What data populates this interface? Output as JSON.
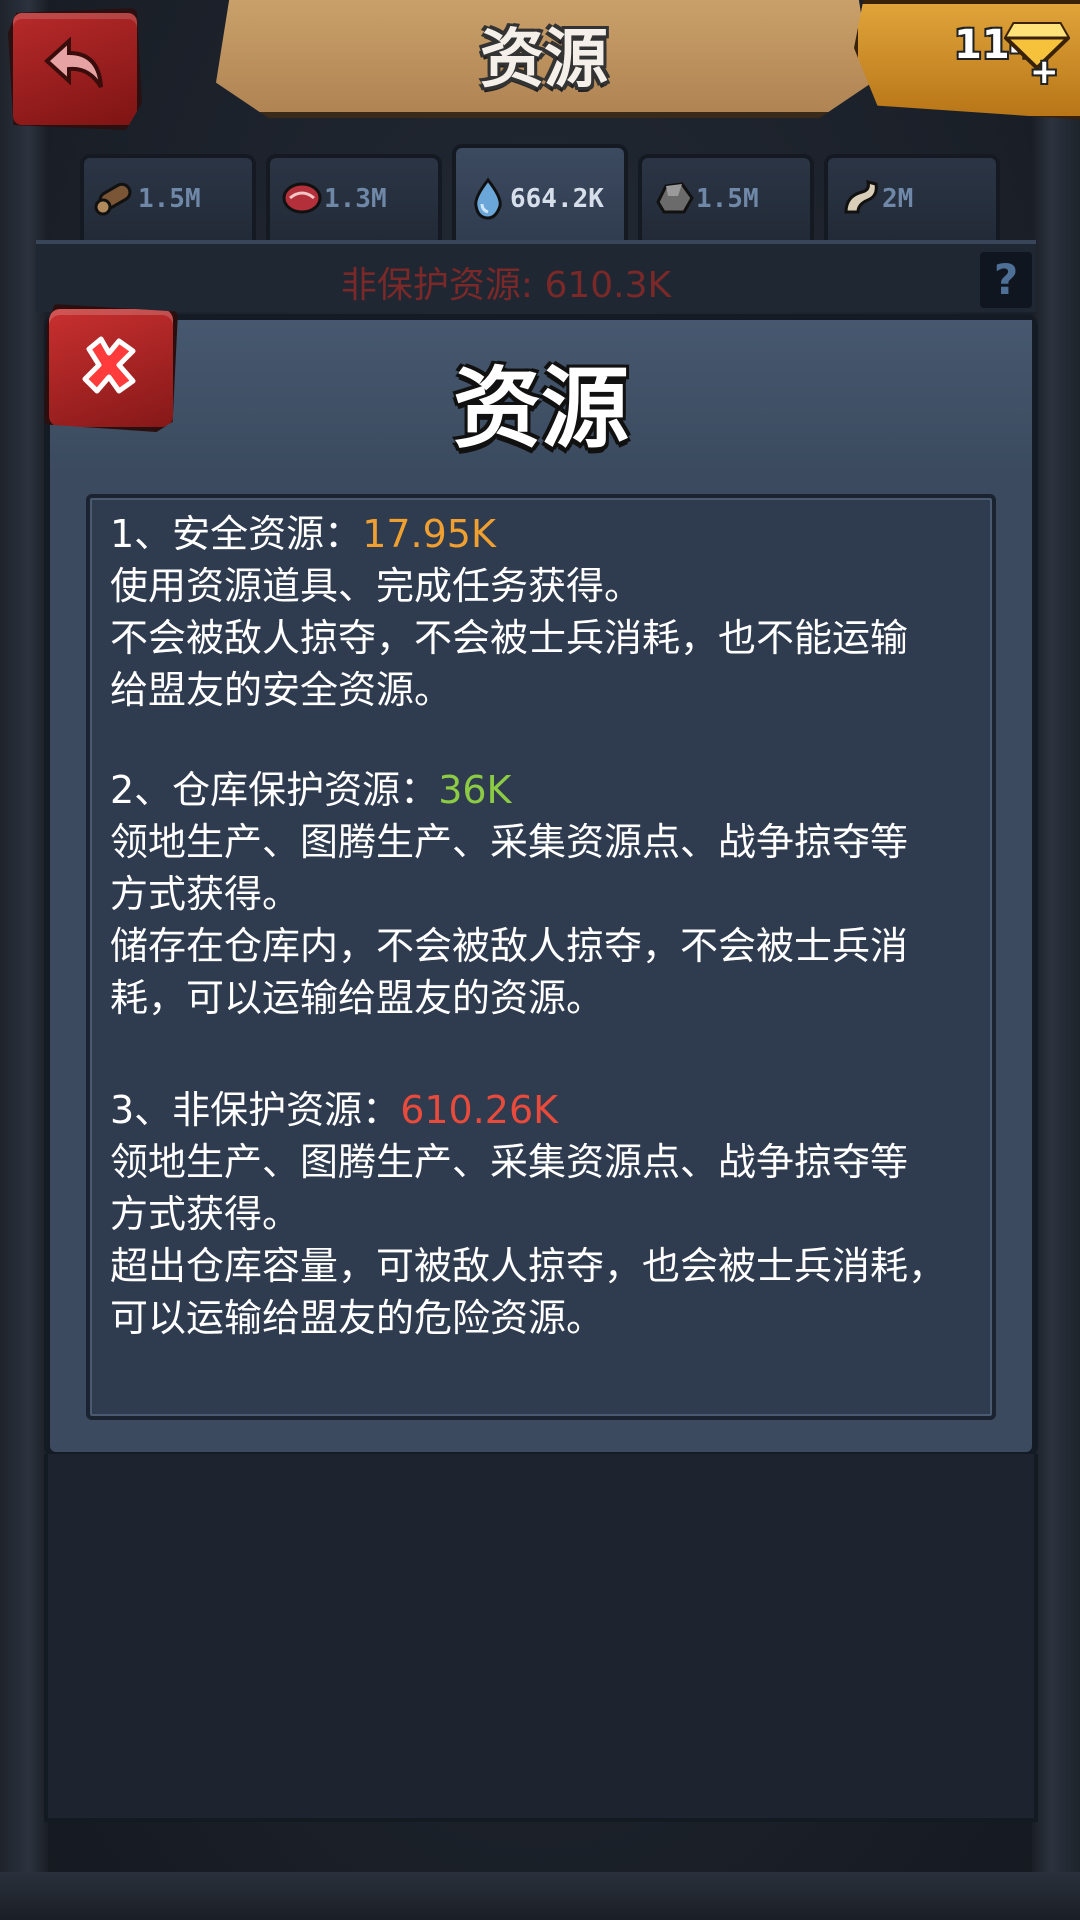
{
  "header": {
    "title": "资源",
    "gem_count": "114",
    "gem_plus": "+"
  },
  "tabs": [
    {
      "icon": "wood-log-icon",
      "value": "1.5M",
      "active": false
    },
    {
      "icon": "meat-icon",
      "value": "1.3M",
      "active": false
    },
    {
      "icon": "water-drop-icon",
      "value": "664.2K",
      "active": true
    },
    {
      "icon": "stone-icon",
      "value": "1.5M",
      "active": false
    },
    {
      "icon": "bone-icon",
      "value": "2M",
      "active": false
    }
  ],
  "unprotected_bar": {
    "text": "非保护资源: 610.3K",
    "help": "?"
  },
  "dialog": {
    "title": "资源",
    "sections": [
      {
        "heading": "1、安全资源：",
        "amount": "17.95K",
        "amount_color": "#f0a030",
        "line1": "使用资源道具、完成任务获得。",
        "line2": "不会被敌人掠夺，不会被士兵消耗，也不能运输",
        "line3": "给盟友的安全资源。",
        "line4": ""
      },
      {
        "heading": "2、仓库保护资源：",
        "amount": "36K",
        "amount_color": "#8ccc44",
        "line1": "领地生产、图腾生产、采集资源点、战争掠夺等",
        "line2": "方式获得。",
        "line3": "储存在仓库内，不会被敌人掠夺，不会被士兵消",
        "line4": "耗，可以运输给盟友的资源。"
      },
      {
        "heading": "3、非保护资源：",
        "amount": "610.26K",
        "amount_color": "#e84a3c",
        "line1": "领地生产、图腾生产、采集资源点、战争掠夺等",
        "line2": "方式获得。",
        "line3": "超出仓库容量，可被敌人掠夺，也会被士兵消耗，",
        "line4": "可以运输给盟友的危险资源。"
      }
    ]
  },
  "colors": {
    "accent_red": "#b82a2a",
    "banner_tan": "#c9a06a",
    "panel_blue": "#3b4a5e"
  }
}
